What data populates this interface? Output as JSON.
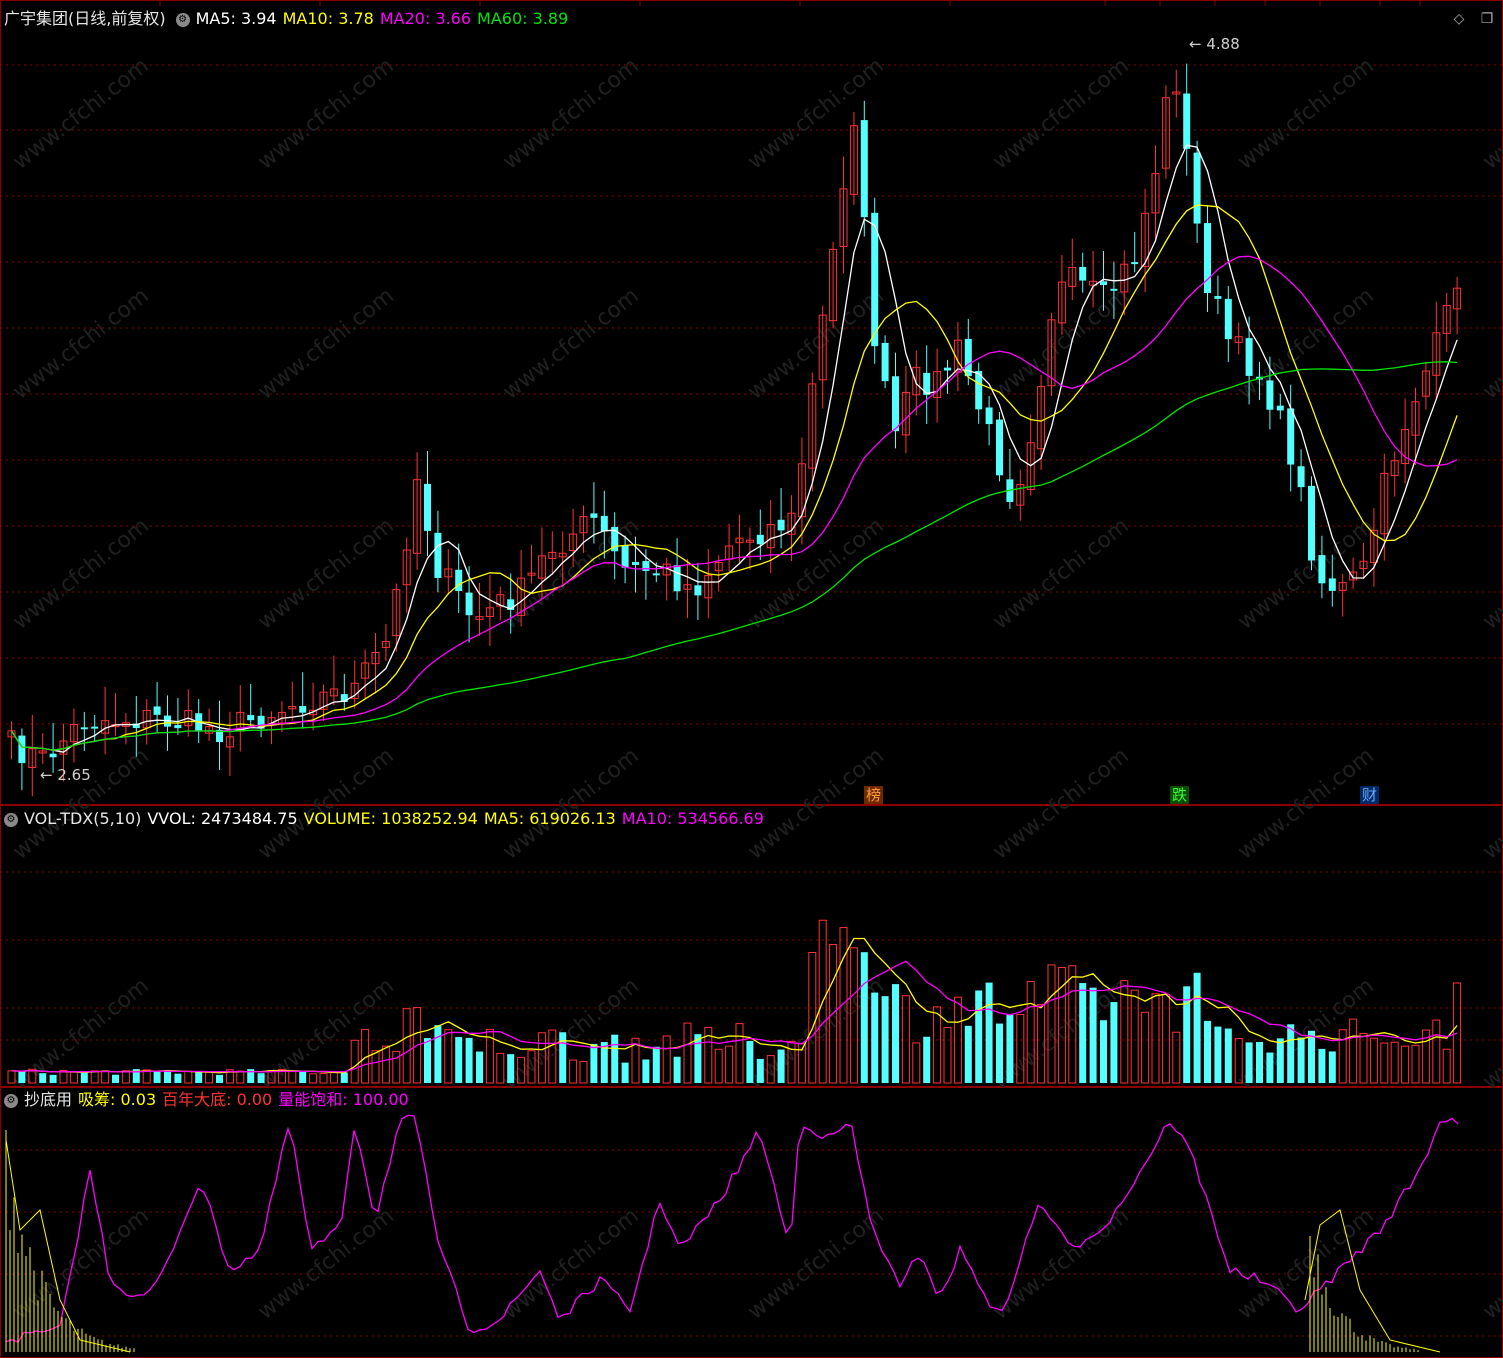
{
  "main": {
    "title": "广宇集团(日线,前复权)",
    "ma5_label": "MA5: 3.94",
    "ma10_label": "MA10: 3.78",
    "ma20_label": "MA20: 3.66",
    "ma60_label": "MA60: 3.89",
    "high_marker": "4.88",
    "low_marker": "2.65",
    "tags": [
      "榜",
      "跌",
      "财"
    ]
  },
  "vol": {
    "name": "VOL-TDX(5,10)",
    "vvol": "VVOL: 2473484.75",
    "volume": "VOLUME: 1038252.94",
    "ma5": "MA5: 619026.13",
    "ma10": "MA10: 534566.69"
  },
  "ind": {
    "name": "抄底用",
    "xichou": "吸筹: 0.03",
    "dadi": "百年大底: 0.00",
    "liangneng": "量能饱和: 100.00"
  },
  "colors": {
    "up": "#ff3232",
    "down": "#54ffff",
    "ma5": "#ffffff",
    "ma10": "#ffff00",
    "ma20": "#ff00ff",
    "ma60": "#00e600",
    "grid": "#8a0000"
  },
  "icons": {
    "menu_toggle": "gear-icon",
    "diamond": "diamond-icon",
    "window": "window-icon"
  },
  "watermark": "www.cfchi.com"
}
